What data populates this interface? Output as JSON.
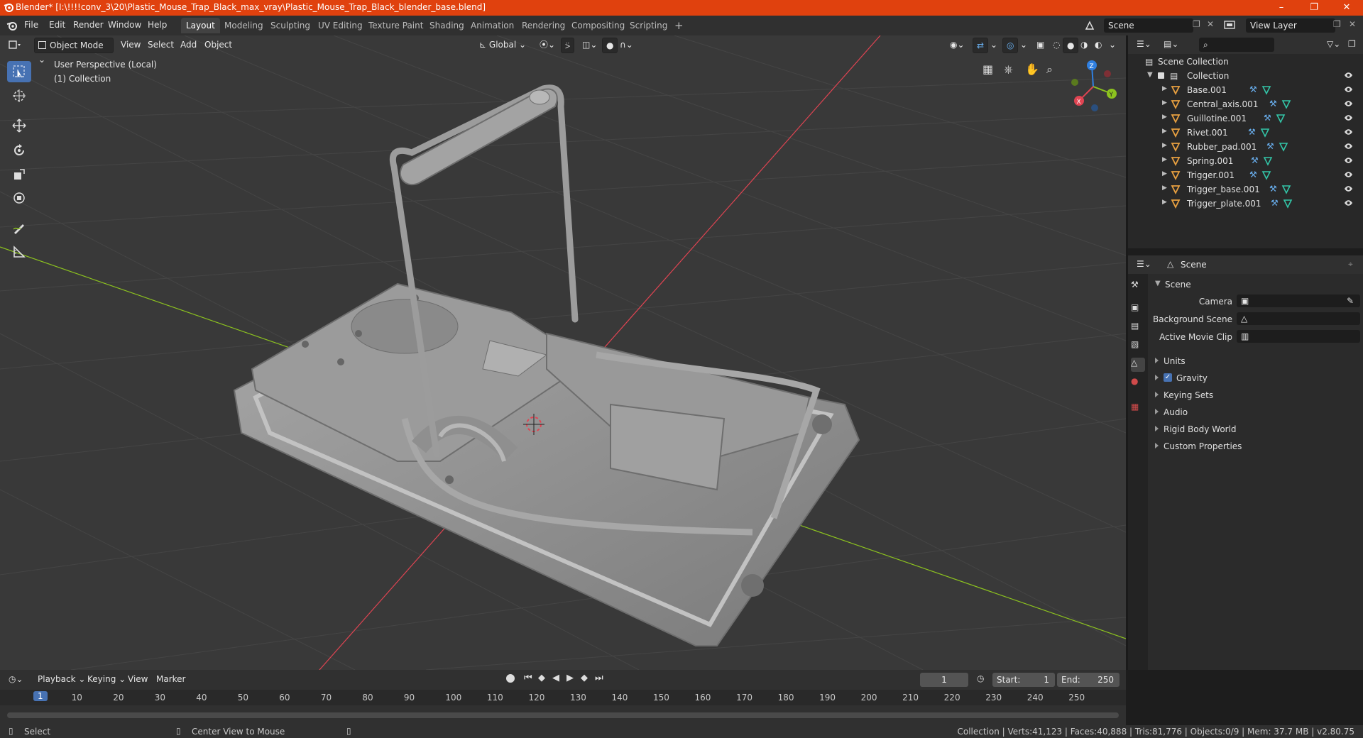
{
  "window": {
    "title": "Blender* [I:\\!!!!conv_3\\20\\Plastic_Mouse_Trap_Black_max_vray\\Plastic_Mouse_Trap_Black_blender_base.blend]"
  },
  "menu": [
    "File",
    "Edit",
    "Render",
    "Window",
    "Help"
  ],
  "workspaces": [
    "Layout",
    "Modeling",
    "Sculpting",
    "UV Editing",
    "Texture Paint",
    "Shading",
    "Animation",
    "Rendering",
    "Compositing",
    "Scripting"
  ],
  "scene_field": "Scene",
  "view_layer_field": "View Layer",
  "viewport_header": {
    "mode": "Object Mode",
    "menus": [
      "View",
      "Select",
      "Add",
      "Object"
    ],
    "orientation": "Global"
  },
  "viewport_overlay": {
    "line1": "User Perspective (Local)",
    "line2": "(1) Collection"
  },
  "gizmo": {
    "x": "X",
    "y": "Y",
    "z": "Z"
  },
  "outliner": {
    "root": "Scene Collection",
    "collection": "Collection",
    "objects": [
      "Base.001",
      "Central_axis.001",
      "Guillotine.001",
      "Rivet.001",
      "Rubber_pad.001",
      "Spring.001",
      "Trigger.001",
      "Trigger_base.001",
      "Trigger_plate.001"
    ]
  },
  "properties": {
    "header": "Scene",
    "panel": "Scene",
    "fields": [
      {
        "label": "Camera"
      },
      {
        "label": "Background Scene"
      },
      {
        "label": "Active Movie Clip"
      }
    ],
    "sections": [
      "Units",
      "Gravity",
      "Keying Sets",
      "Audio",
      "Rigid Body World",
      "Custom Properties"
    ]
  },
  "timeline": {
    "menus": [
      "Playback",
      "Keying",
      "View",
      "Marker"
    ],
    "current_frame": "1",
    "start_label": "Start:",
    "start": "1",
    "end_label": "End:",
    "end": "250",
    "ticks": [
      "1",
      "10",
      "20",
      "30",
      "40",
      "50",
      "60",
      "70",
      "80",
      "90",
      "100",
      "110",
      "120",
      "130",
      "140",
      "150",
      "160",
      "170",
      "180",
      "190",
      "200",
      "210",
      "220",
      "230",
      "240",
      "250"
    ]
  },
  "status": {
    "left1": "Select",
    "left2": "Center View to Mouse",
    "right": "Collection | Verts:41,123 | Faces:40,888 | Tris:81,776 | Objects:0/9 | Mem: 37.7 MB | v2.80.75"
  },
  "colors": {
    "titlebar": "#e0410e",
    "accent": "#4772b3",
    "mesh": "#8d8d8d",
    "x_axis": "#e04452",
    "y_axis": "#8cc21f",
    "z_axis": "#2f7fe0",
    "mesh_icon": "#e8a040",
    "modifier_icon": "#6ab0f0",
    "data_icon": "#33c6a8"
  }
}
